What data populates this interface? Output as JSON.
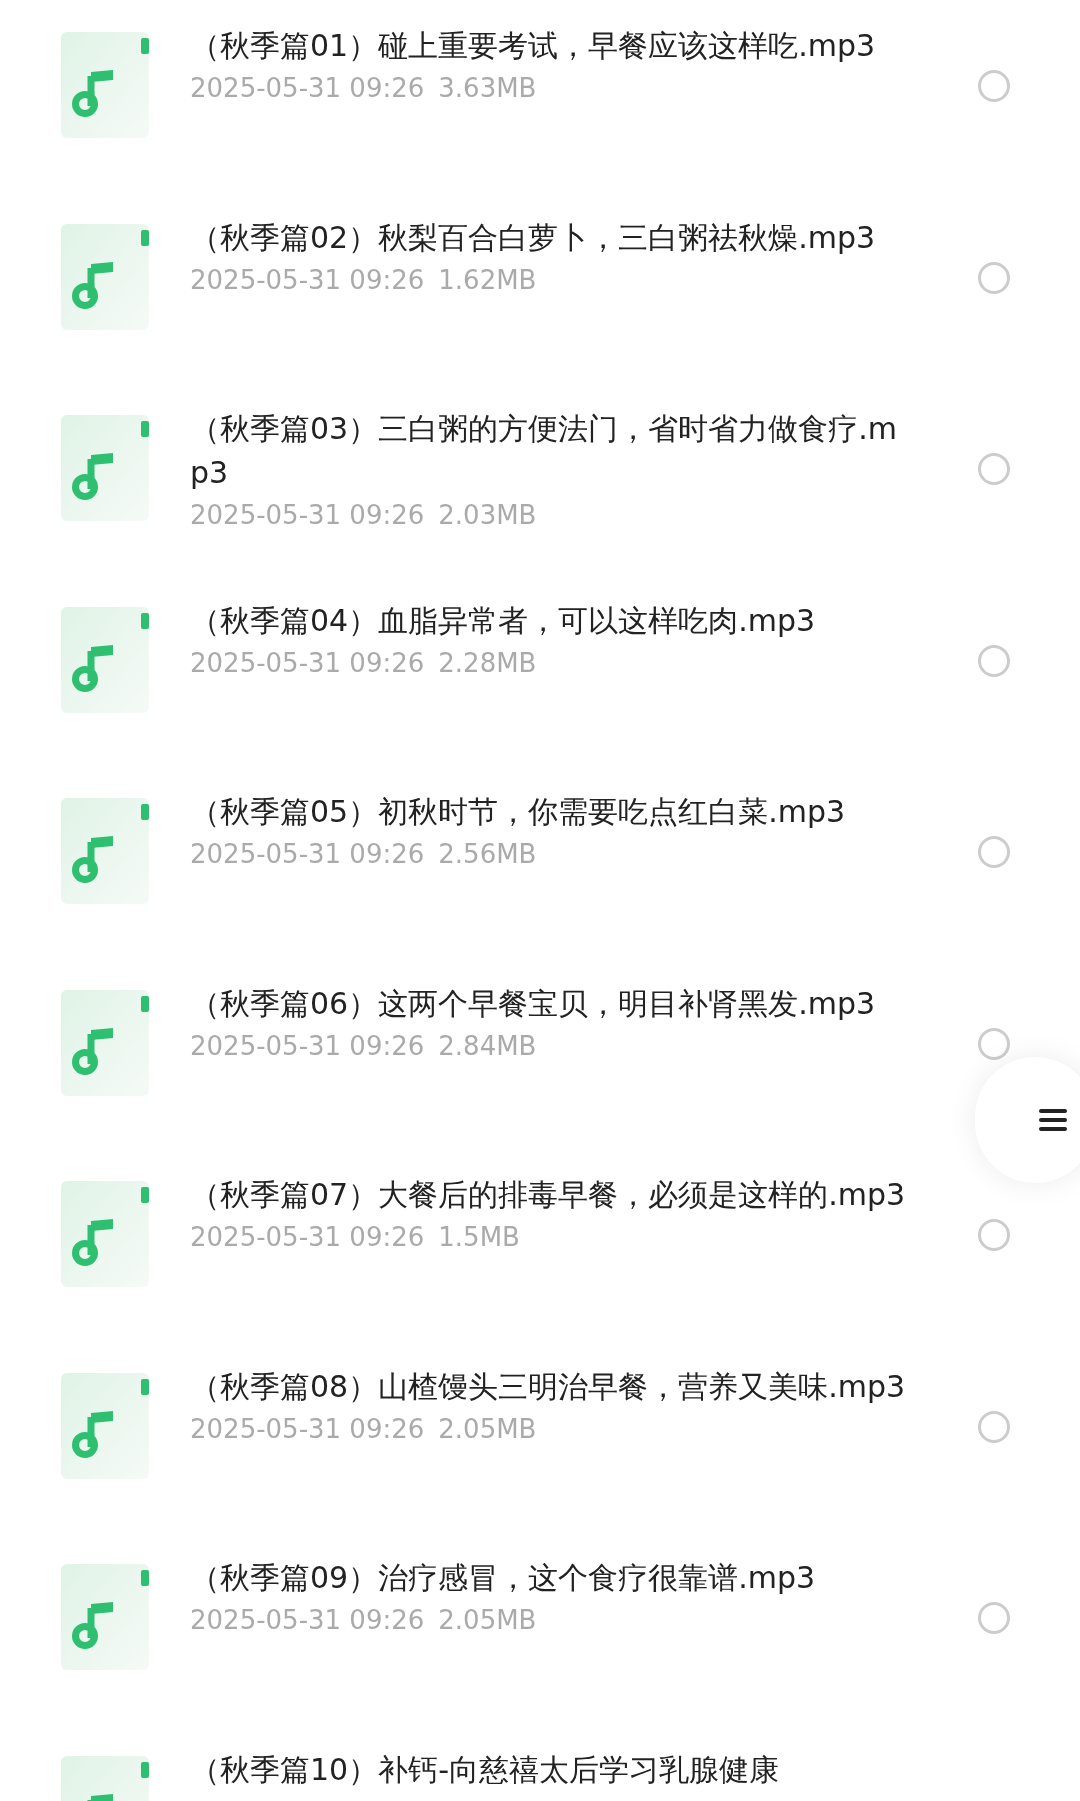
{
  "files": [
    {
      "name": "（秋季篇01）碰上重要考试，早餐应该这样吃.mp3",
      "date": "2025-05-31 09:26",
      "size": "3.63MB",
      "selected": false
    },
    {
      "name": "（秋季篇02）秋梨百合白萝卜，三白粥祛秋燥.mp3",
      "date": "2025-05-31 09:26",
      "size": "1.62MB",
      "selected": false
    },
    {
      "name": "（秋季篇03）三白粥的方便法门，省时省力做食疗.mp3",
      "date": "2025-05-31 09:26",
      "size": "2.03MB",
      "selected": false
    },
    {
      "name": "（秋季篇04）血脂异常者，可以这样吃肉.mp3",
      "date": "2025-05-31 09:26",
      "size": "2.28MB",
      "selected": false
    },
    {
      "name": "（秋季篇05）初秋时节，你需要吃点红白菜.mp3",
      "date": "2025-05-31 09:26",
      "size": "2.56MB",
      "selected": false
    },
    {
      "name": "（秋季篇06）这两个早餐宝贝，明目补肾黑发.mp3",
      "date": "2025-05-31 09:26",
      "size": "2.84MB",
      "selected": false
    },
    {
      "name": "（秋季篇07）大餐后的排毒早餐，必须是这样的.mp3",
      "date": "2025-05-31 09:26",
      "size": "1.5MB",
      "selected": false
    },
    {
      "name": "（秋季篇08）山楂馒头三明治早餐，营养又美味.mp3",
      "date": "2025-05-31 09:26",
      "size": "2.05MB",
      "selected": false
    },
    {
      "name": "（秋季篇09）治疗感冒，这个食疗很靠谱.mp3",
      "date": "2025-05-31 09:26",
      "size": "2.05MB",
      "selected": false
    },
    {
      "name": "（秋季篇10）补钙-向慈禧太后学习乳腺健康"
    }
  ]
}
